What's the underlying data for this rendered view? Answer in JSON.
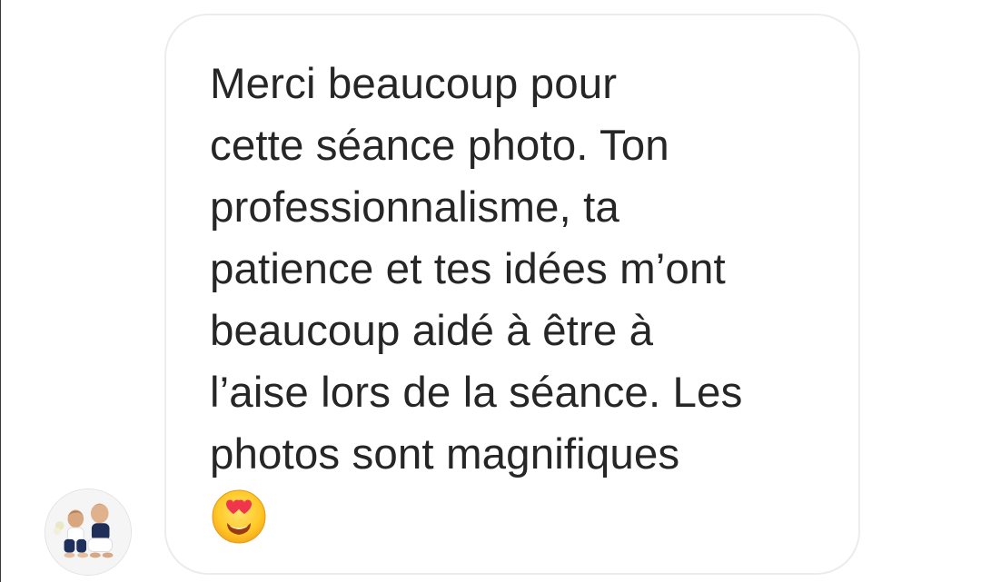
{
  "conversation": {
    "message": {
      "text": "Merci beaucoup pour\ncette séance photo. Ton\nprofessionnalisme, ta\npatience et tes idées m’ont\nbeaucoup aidé à être à\nl’aise lors de la séance. Les\nphotos sont magnifiques",
      "emoji": "heart-eyes-emoji"
    },
    "sender": {
      "avatar": "avatar-photo"
    }
  },
  "colors": {
    "bubble_border": "#ececec",
    "text": "#262626",
    "background": "#ffffff"
  }
}
